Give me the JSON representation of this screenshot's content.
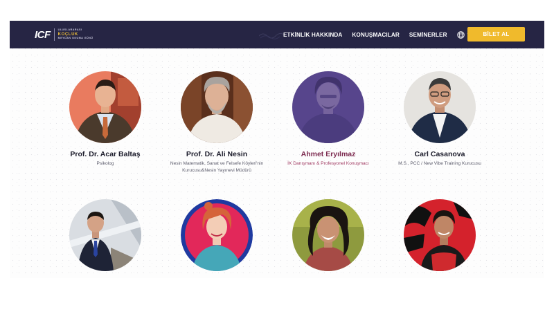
{
  "brand": {
    "logo_mark": "ICF",
    "logo_line1": "ULUSLARARASI",
    "logo_line2": "KOÇLUK",
    "logo_line3": "MEYDAN OKUMA GÜNÜ"
  },
  "nav": {
    "links": [
      "ETKİNLİK HAKKINDA",
      "KONUŞMACILAR",
      "SEMİNERLER"
    ],
    "language_icon": "globe-icon",
    "cta": "BİLET AL"
  },
  "colors": {
    "navbar": "#262544",
    "cta": "#f0ba2c",
    "highlight_name": "#7d2b50",
    "highlight_title": "#a03a62"
  },
  "speakers": [
    {
      "name": "Prof. Dr. Acar Baltaş",
      "title": "Psikolog"
    },
    {
      "name": "Prof. Dr. Ali Nesin",
      "title": "Nesin Matematik, Sanat ve Felsefe Köyleri'nin Kurucusu&Nesin Yayınevi Müdürü"
    },
    {
      "name": "Ahmet Eryılmaz",
      "title": "İK Danışmanı & Profesyonel Konuşmacı",
      "highlighted": true
    },
    {
      "name": "Carl Casanova",
      "title": "M.S., PCC / New Vibe Training Kurucusu"
    },
    {
      "name": "",
      "title": ""
    },
    {
      "name": "",
      "title": ""
    },
    {
      "name": "",
      "title": ""
    },
    {
      "name": "",
      "title": ""
    }
  ]
}
